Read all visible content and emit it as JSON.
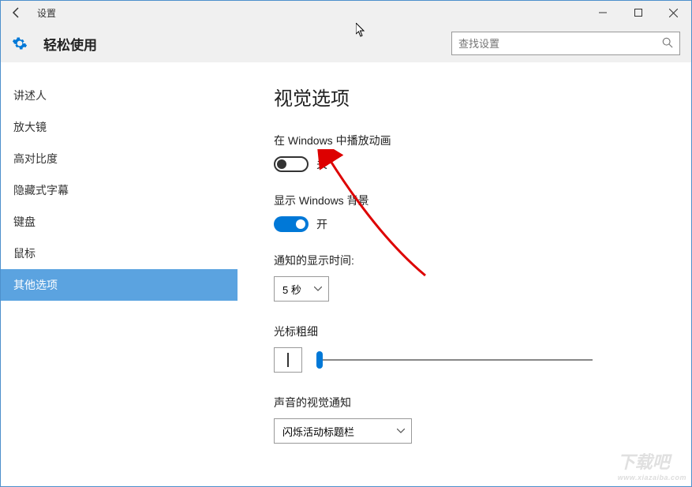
{
  "window": {
    "title": "设置"
  },
  "header": {
    "title": "轻松使用",
    "search_placeholder": "查找设置"
  },
  "sidebar": {
    "items": [
      {
        "label": "讲述人"
      },
      {
        "label": "放大镜"
      },
      {
        "label": "高对比度"
      },
      {
        "label": "隐藏式字幕"
      },
      {
        "label": "键盘"
      },
      {
        "label": "鼠标"
      },
      {
        "label": "其他选项"
      }
    ],
    "selected_index": 6
  },
  "content": {
    "page_title": "视觉选项",
    "animations": {
      "label": "在 Windows 中播放动画",
      "state": "关"
    },
    "background": {
      "label": "显示 Windows 背景",
      "state": "开"
    },
    "notification_time": {
      "label": "通知的显示时间:",
      "value": "5 秒"
    },
    "cursor_thickness": {
      "label": "光标粗细"
    },
    "sound_visual": {
      "label": "声音的视觉通知",
      "value": "闪烁活动标题栏"
    }
  },
  "watermark": {
    "name": "下载吧",
    "url": "www.xiazaiba.com"
  }
}
